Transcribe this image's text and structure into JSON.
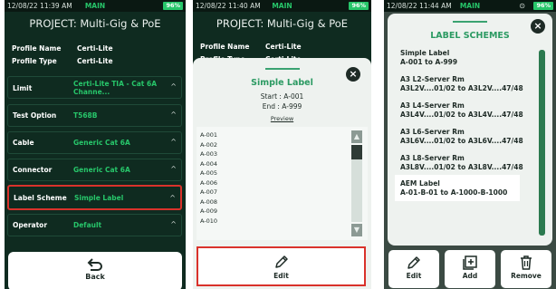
{
  "screen1": {
    "status": {
      "time": "12/08/22 11:39 AM",
      "mode": "MAIN",
      "battery": "96%"
    },
    "title": "PROJECT: Multi-Gig & PoE",
    "info": [
      {
        "label": "Profile Name",
        "value": "Certi-Lite"
      },
      {
        "label": "Profile Type",
        "value": "Certi-Lite"
      }
    ],
    "rows": [
      {
        "label": "Limit",
        "value_line1": "Certi-Lite TIA - Cat 6A",
        "value_line2": "Channe..."
      },
      {
        "label": "Test Option",
        "value": "T568B"
      },
      {
        "label": "Cable",
        "value": "Generic Cat 6A"
      },
      {
        "label": "Connector",
        "value": "Generic Cat 6A"
      },
      {
        "label": "Label Scheme",
        "value": "Simple Label"
      },
      {
        "label": "Operator",
        "value": "Default"
      }
    ],
    "back_label": "Back"
  },
  "screen2": {
    "status": {
      "time": "12/08/22 11:40 AM",
      "mode": "MAIN",
      "battery": "96%"
    },
    "title": "PROJECT: Multi-Gig & PoE",
    "info": [
      {
        "label": "Profile Name",
        "value": "Certi-Lite"
      },
      {
        "label": "Profile Type",
        "value": "Certi-Lite"
      }
    ],
    "sheet_title": "Simple Label",
    "start_line": "Start : A-001",
    "end_line": "End : A-999",
    "preview_link": "Preview",
    "list": [
      "A-001",
      "A-002",
      "A-003",
      "A-004",
      "A-005",
      "A-006",
      "A-007",
      "A-008",
      "A-009",
      "A-010"
    ],
    "edit_label": "Edit"
  },
  "screen3": {
    "status": {
      "time": "12/08/22 11:44 AM",
      "mode": "MAIN",
      "battery": "96%"
    },
    "sheet_title": "LABEL SCHEMES",
    "schemes": [
      {
        "name": "Simple Label",
        "detail": "A-001 to A-999"
      },
      {
        "name": "A3 L2-Server Rm",
        "detail": "A3L2V....01/02 to A3L2V....47/48"
      },
      {
        "name": "A3 L4-Server Rm",
        "detail": "A3L4V....01/02 to A3L4V....47/48"
      },
      {
        "name": "A3 L6-Server Rm",
        "detail": "A3L6V....01/02 to A3L6V....47/48"
      },
      {
        "name": "A3 L8-Server Rm",
        "detail": "A3L8V....01/02 to A3L8V....47/48"
      },
      {
        "name": "AEM Label",
        "detail": "A-01-B-01 to A-1000-B-1000"
      }
    ],
    "buttons": {
      "edit": "Edit",
      "add": "Add",
      "remove": "Remove"
    }
  },
  "colors": {
    "accent_green": "#27c66a",
    "dark_bg": "#0f2b20",
    "highlight_red": "#d9322b"
  }
}
